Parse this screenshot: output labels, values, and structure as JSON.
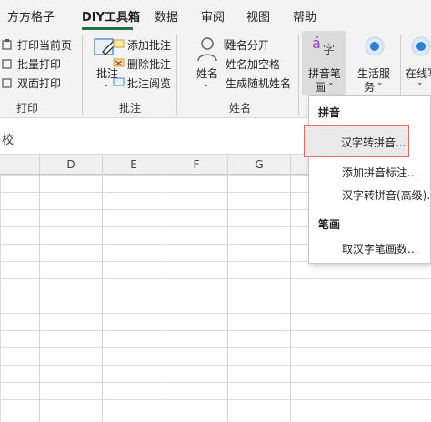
{
  "menu_tabs": [
    "方方格子",
    "DIY工具箱",
    "数据",
    "审阅",
    "视图",
    "帮助"
  ],
  "print_group": {
    "items": [
      "打印当前页",
      "批量打印",
      "双面打印"
    ],
    "label": "打印"
  },
  "annotate_group": {
    "big_button": "批注",
    "items": [
      "添加批注",
      "删除批注",
      "批注阅览"
    ],
    "label": "批注"
  },
  "name_group": {
    "big_button": "姓名",
    "items": [
      "姓名分开",
      "姓名加空格",
      "生成随机姓名"
    ],
    "label": "姓名"
  },
  "pinyin_button": {
    "line1": "拼音笔",
    "line2": "画"
  },
  "life_button": {
    "line1": "生活服",
    "line2": "务"
  },
  "online_button": {
    "line1": "在线写",
    "line2": ""
  },
  "formula_text": "校",
  "columns": [
    "D",
    "E",
    "F",
    "G"
  ],
  "dropdown": {
    "section1": "拼音",
    "items1": [
      "汉字转拼音...",
      "添加拼音标注...",
      "汉字转拼音(高级)..."
    ],
    "section2": "笔画",
    "items2": [
      "取汉字笔画数..."
    ]
  },
  "colors": {
    "accent": "#217346",
    "highlight_border": "#e36b63",
    "icon_blue": "#2f7fd9",
    "pinyin_purple": "#9b3fc0"
  }
}
